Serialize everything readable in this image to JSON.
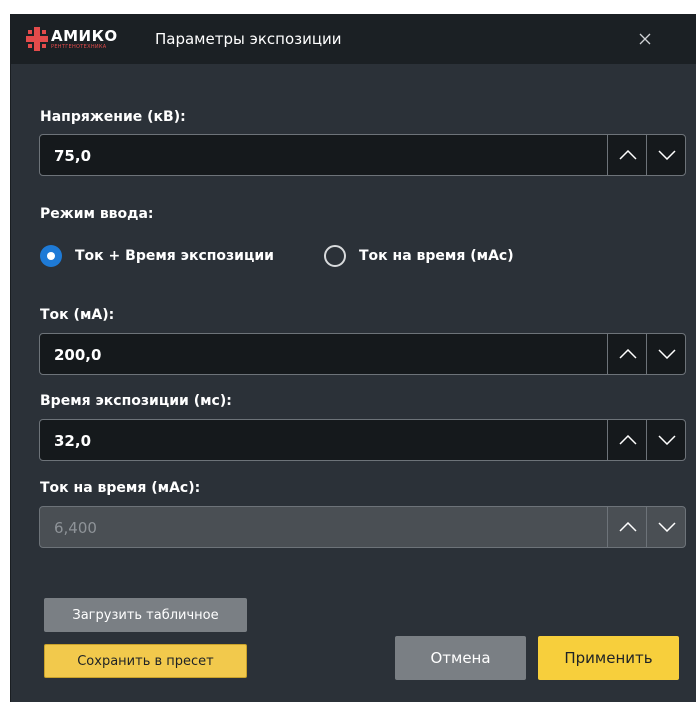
{
  "window": {
    "logo_text": "АМИКО",
    "logo_subtext": "РЕНТГЕНОТЕХНИКА",
    "title": "Параметры экспозиции",
    "close_symbol": "✕"
  },
  "voltage": {
    "label": "Напряжение (кВ):",
    "value": "75,0"
  },
  "mode": {
    "label": "Режим ввода:",
    "options": [
      {
        "label": "Ток + Время экспозиции",
        "checked": true
      },
      {
        "label": "Ток на время (мАс)",
        "checked": false
      }
    ]
  },
  "current": {
    "label": "Ток (мА):",
    "value": "200,0"
  },
  "exposure_time": {
    "label": "Время экспозиции (мс):",
    "value": "32,0"
  },
  "mas": {
    "label": "Ток на время (мАс):",
    "value": "6,400",
    "disabled": true
  },
  "buttons": {
    "load_table": "Загрузить табличное",
    "save_preset": "Сохранить в пресет",
    "cancel": "Отмена",
    "apply": "Применить"
  },
  "colors": {
    "accent_blue": "#1e7ad6",
    "accent_yellow": "#f7cf3c",
    "brand_red": "#e34b4b",
    "dialog_background": "#2b3138",
    "titlebar_background": "#1b2024"
  },
  "icons": {
    "spin_up": "chevron-up-icon",
    "spin_down": "chevron-down-icon",
    "close": "close-icon"
  }
}
